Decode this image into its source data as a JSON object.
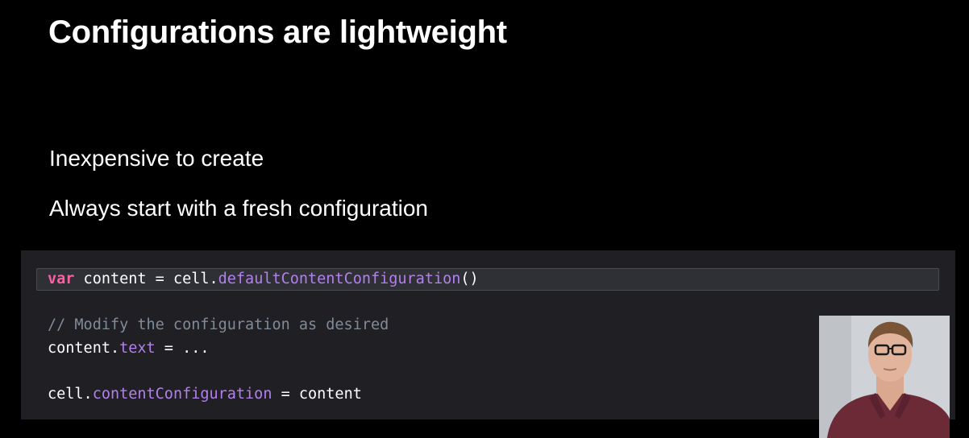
{
  "slide": {
    "title": "Configurations are lightweight",
    "bullets": [
      "Inexpensive to create",
      "Always start with a fresh configuration"
    ]
  },
  "code": {
    "line1": {
      "keyword": "var",
      "text_a": " content = cell.",
      "func": "defaultContentConfiguration",
      "text_b": "()"
    },
    "line2": {
      "comment": "// Modify the configuration as desired"
    },
    "line3": {
      "text_a": "content.",
      "prop": "text",
      "text_b": " = ..."
    },
    "line4": {
      "text_a": "cell.",
      "prop": "contentConfiguration",
      "text_b": " = content"
    }
  },
  "colors": {
    "background": "#000000",
    "code_background": "#1f1f24",
    "keyword": "#fc5fa3",
    "function": "#b281eb",
    "comment": "#7f8c98"
  },
  "presenter": {
    "icon": "presenter-video-feed"
  }
}
